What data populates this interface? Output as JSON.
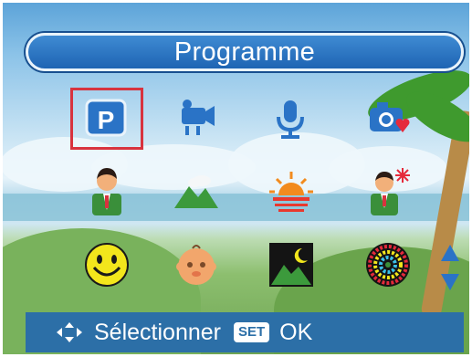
{
  "header": {
    "title": "Programme"
  },
  "modes": [
    {
      "name": "program-mode-icon",
      "selected": true
    },
    {
      "name": "movie-mode-icon"
    },
    {
      "name": "voice-record-icon"
    },
    {
      "name": "favorite-camera-icon"
    },
    {
      "name": "portrait-icon"
    },
    {
      "name": "landscape-icon"
    },
    {
      "name": "sunset-icon"
    },
    {
      "name": "night-portrait-icon"
    },
    {
      "name": "smile-icon"
    },
    {
      "name": "child-icon"
    },
    {
      "name": "night-landscape-icon"
    },
    {
      "name": "fireworks-icon"
    }
  ],
  "footer": {
    "select_label": "Sélectionner",
    "set_badge": "SET",
    "ok_label": "OK"
  },
  "colors": {
    "bar": "#1e64b3",
    "highlight": "#d8333e",
    "footer": "#2c6fa7"
  }
}
